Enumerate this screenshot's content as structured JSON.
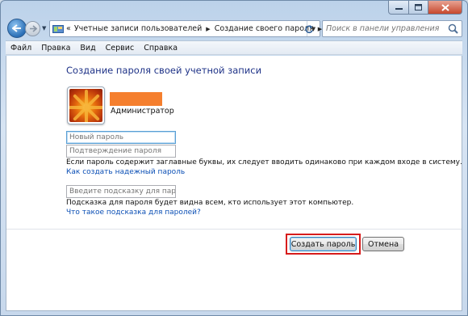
{
  "address_bar": {
    "prefix": "«",
    "crumbs": [
      "Учетные записи пользователей",
      "Создание своего пароля"
    ]
  },
  "search": {
    "placeholder": "Поиск в панели управления"
  },
  "menu": [
    "Файл",
    "Правка",
    "Вид",
    "Сервис",
    "Справка"
  ],
  "page": {
    "heading": "Создание пароля своей учетной записи",
    "username": "Администратор",
    "new_password_placeholder": "Новый пароль",
    "confirm_password_placeholder": "Подтверждение пароля",
    "case_note": "Если пароль содержит заглавные буквы, их следует вводить одинаково при каждом входе в систему.",
    "strong_password_link": "Как создать надежный пароль",
    "hint_placeholder": "Введите подсказку для пароля",
    "hint_note": "Подсказка для пароля будет видна всем, кто использует этот компьютер.",
    "hint_link": "Что такое подсказка для паролей?"
  },
  "buttons": {
    "create": "Создать пароль",
    "cancel": "Отмена"
  },
  "colors": {
    "heading": "#1e3287",
    "link": "#0b4fb5",
    "highlight": "#d71c1c",
    "redaction": "#f57f2e"
  }
}
